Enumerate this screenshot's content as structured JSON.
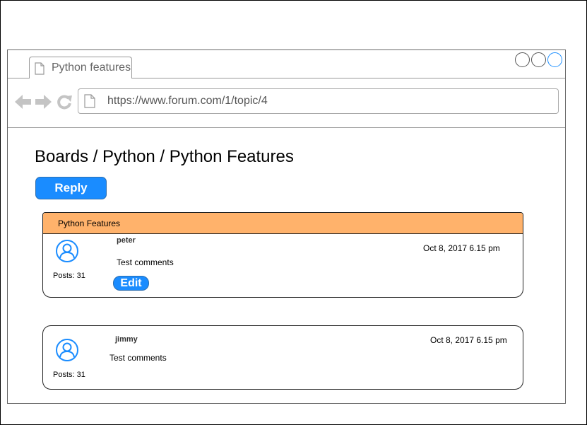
{
  "browser": {
    "tab_title": "Python features",
    "url": "https://www.forum.com/1/topic/4"
  },
  "page": {
    "breadcrumb": "Boards / Python / Python Features",
    "reply_label": "Reply"
  },
  "topic": {
    "title": "Python Features"
  },
  "posts": [
    {
      "username": "peter",
      "date": "Oct 8, 2017 6.15 pm",
      "comment": "Test comments",
      "posts_count": "Posts: 31",
      "edit_label": "Edit"
    },
    {
      "username": "jimmy",
      "date": "Oct 8, 2017 6.15 pm",
      "comment": "Test comments",
      "posts_count": "Posts: 31"
    }
  ],
  "colors": {
    "accent": "#1a8cff",
    "topic_header": "#ffb26b"
  },
  "icons": [
    "page-icon",
    "back-arrow-icon",
    "forward-arrow-icon",
    "reload-icon",
    "user-avatar-icon"
  ]
}
